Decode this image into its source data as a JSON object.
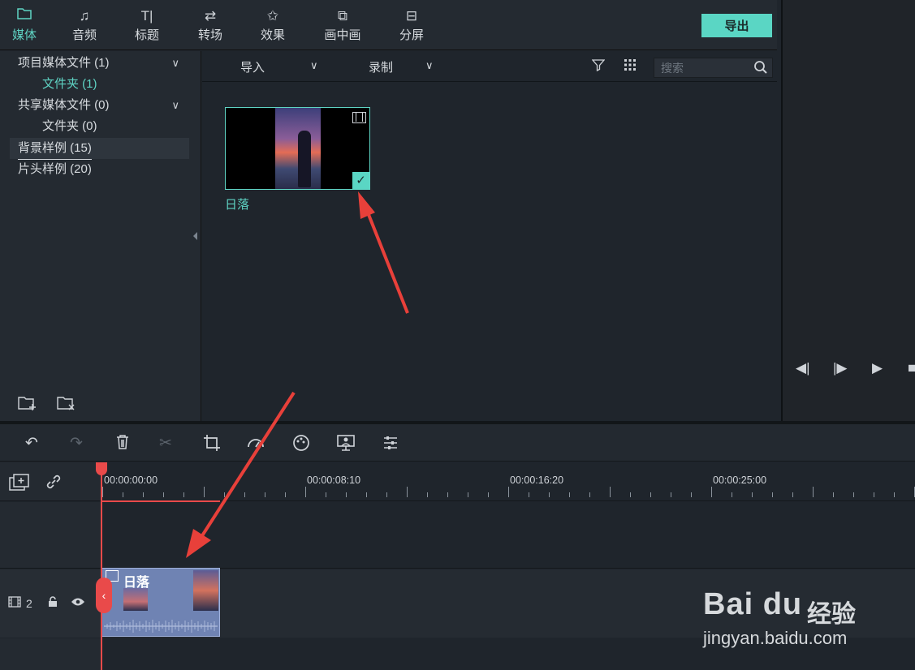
{
  "nav": {
    "tabs": [
      {
        "label": "媒体",
        "icon": "folder-icon",
        "active": true
      },
      {
        "label": "音频",
        "icon": "music-note-icon"
      },
      {
        "label": "标题",
        "icon": "text-icon"
      },
      {
        "label": "转场",
        "icon": "transition-icon"
      },
      {
        "label": "效果",
        "icon": "effects-icon"
      },
      {
        "label": "画中画",
        "icon": "pip-icon"
      },
      {
        "label": "分屏",
        "icon": "split-screen-icon"
      }
    ],
    "export_label": "导出"
  },
  "media_tree": [
    {
      "label": "项目媒体文件 (1)",
      "expandable": true
    },
    {
      "label": "文件夹 (1)",
      "sub": true,
      "active": true
    },
    {
      "label": "共享媒体文件 (0)",
      "expandable": true
    },
    {
      "label": "文件夹 (0)",
      "sub": true
    },
    {
      "label": "背景样例 (15)",
      "selected": true
    },
    {
      "label": "片头样例 (20)"
    }
  ],
  "library": {
    "import_label": "导入",
    "record_label": "录制",
    "search_placeholder": "搜索",
    "items": [
      {
        "label": "日落",
        "selected": true
      }
    ]
  },
  "timeline": {
    "timecodes": [
      "00:00:00:00",
      "00:00:08:10",
      "00:00:16:20",
      "00:00:25:00"
    ],
    "track_number": "2",
    "clip_title": "日落"
  },
  "watermark": {
    "brand": "Bai du",
    "cn": "经验",
    "url": "jingyan.baidu.com"
  },
  "colors": {
    "accent": "#5ad6c4",
    "playhead": "#e94a4a",
    "clip": "#6f83b3"
  }
}
